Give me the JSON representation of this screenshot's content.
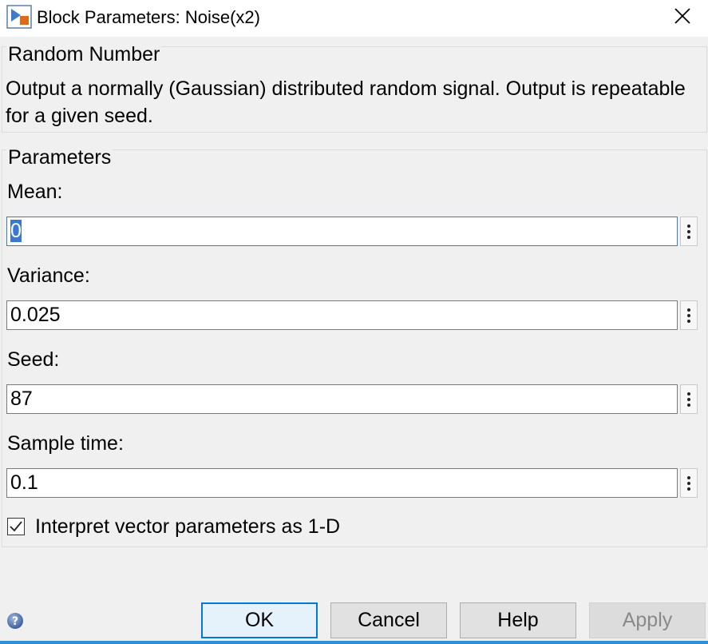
{
  "window": {
    "title": "Block Parameters: Noise(x2)",
    "icons": {
      "app": "simulink-block-icon",
      "close": "close-icon"
    }
  },
  "description_group": {
    "label": "Random Number",
    "text": "Output a normally (Gaussian) distributed random signal.  Output is repeatable for a given seed."
  },
  "parameters_group": {
    "label": "Parameters",
    "fields": [
      {
        "label": "Mean:",
        "value": "0"
      },
      {
        "label": "Variance:",
        "value": "0.025"
      },
      {
        "label": "Seed:",
        "value": "87"
      },
      {
        "label": "Sample time:",
        "value": "0.1"
      }
    ],
    "checkbox": {
      "label": "Interpret vector parameters as 1-D",
      "checked": true
    }
  },
  "buttons": {
    "ok": "OK",
    "cancel": "Cancel",
    "help": "Help",
    "apply": "Apply"
  },
  "colors": {
    "accent": "#0078d7",
    "selection": "#3a78d4",
    "background": "#f0f0f0"
  }
}
